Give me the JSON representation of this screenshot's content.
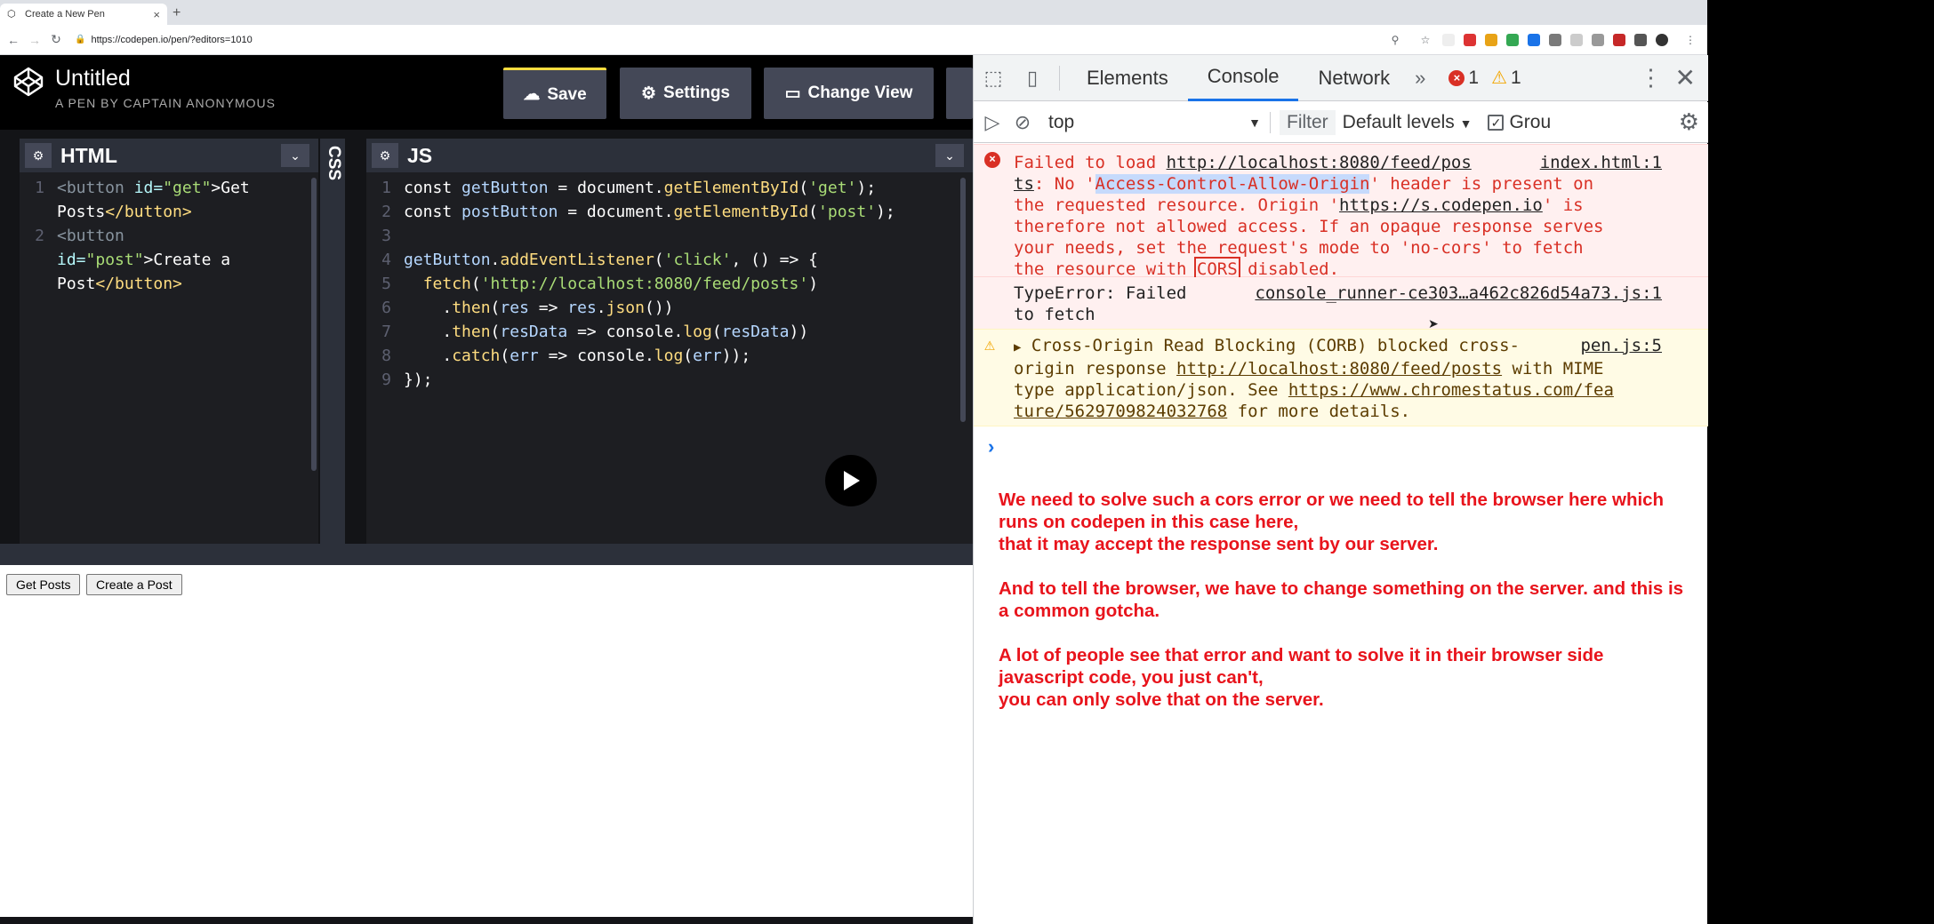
{
  "browser": {
    "tab_title": "Create a New Pen",
    "tab_close": "×",
    "new_tab": "+",
    "url": "https://codepen.io/pen/?editors=1010"
  },
  "codepen": {
    "pen_title": "Untitled",
    "pen_by": "A PEN BY CAPTAIN ANONYMOUS",
    "save_label": "Save",
    "settings_label": "Settings",
    "change_view_label": "Change View",
    "html_title": "HTML",
    "css_title": "CSS",
    "js_title": "JS"
  },
  "html_code": {
    "l1n": "1",
    "l1a": "<button ",
    "l1b": "id=",
    "l1c": "\"get\"",
    "l1d": ">Get",
    "l2": "Posts",
    "l2t": "</button>",
    "l3n": "2",
    "l3a": "<button",
    "l4a": "id=",
    "l4b": "\"post\"",
    "l4c": ">Create a",
    "l5": "Post",
    "l5t": "</button>"
  },
  "js_code": {
    "lines": [
      "const getButton = document.getElementById('get');",
      "const postButton = document.getElementById('post');",
      "",
      "getButton.addEventListener('click', () => {",
      "  fetch('http://localhost:8080/feed/posts')",
      "    .then(res => res.json())",
      "    .then(resData => console.log(resData))",
      "    .catch(err => console.log(err));",
      "});"
    ]
  },
  "preview": {
    "get_posts": "Get Posts",
    "create_post": "Create a Post"
  },
  "devtools": {
    "tabs": [
      "Elements",
      "Console",
      "Network"
    ],
    "more_tabs": "»",
    "error_count": "1",
    "warning_count": "1",
    "context": "top",
    "filter_placeholder": "Filter",
    "levels": "Default levels",
    "group_label": "Grou",
    "error_msg": {
      "pre": "Failed to load ",
      "url": "http://localhost:8080/feed/pos",
      "url2": "ts",
      "mid": ": No '",
      "header": "Access-Control-Allow-Origin",
      "rest1": "' header is present on",
      "line3": "the requested resource. Origin '",
      "origin": "https://s.codepen.io",
      "line3end": "' is",
      "line4": "therefore not allowed access. If an opaque response serves",
      "line5": "your needs, set the request's mode to 'no-cors' to fetch",
      "line6a": "the resource with ",
      "cors": "CORS",
      "line6b": " disabled.",
      "source": "index.html:1"
    },
    "type_error": {
      "line1": "TypeError: Failed",
      "line2": "to fetch",
      "source": "console_runner-ce303…a462c826d54a73.js:1"
    },
    "warning_msg": {
      "line1": "Cross-Origin Read Blocking (CORB) blocked cross-",
      "line2a": "origin response ",
      "line2url": "http://localhost:8080/feed/posts",
      "line2b": " with MIME",
      "line3a": "type application/json. See ",
      "line3url": "https://www.chromestatus.com/fea",
      "line4url": "ture/5629709824032768",
      "line4b": " for more details.",
      "source": "pen.js:5"
    },
    "prompt": "›"
  },
  "notes": {
    "p1": "We need to solve such a cors error or we need to tell the browser here which runs on codepen in this case here,\nthat it may accept the response sent by our server.",
    "p2": "And to tell the browser, we have to change something on the server. and this is a common gotcha.",
    "p3": "A lot of people see that error and want to solve it in their browser side javascript code, you just can't,\nyou can only solve that on the server."
  },
  "colors": {
    "save_accent": "#ffdd40",
    "error_red": "#d93025",
    "note_red": "#e8141c",
    "console_blue": "#1a73e8"
  }
}
